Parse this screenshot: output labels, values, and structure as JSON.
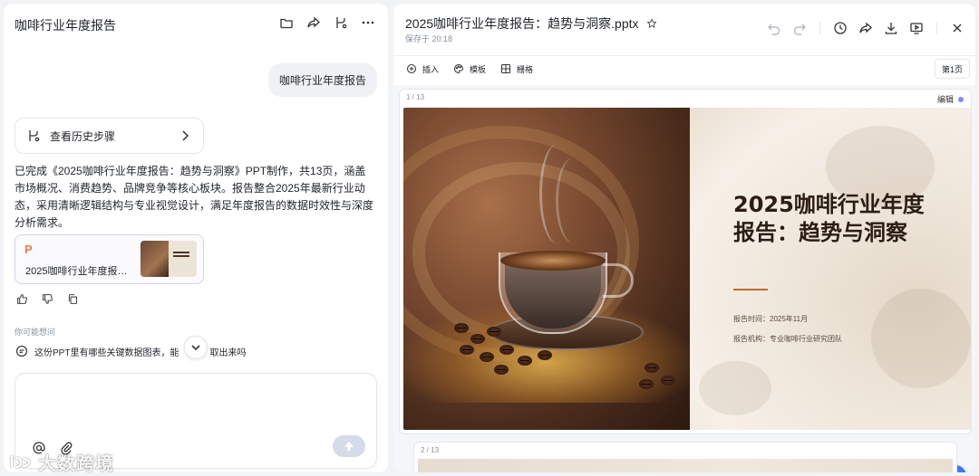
{
  "left_panel": {
    "title": "咖啡行业年度报告",
    "header_icons": [
      "folder-icon",
      "share-icon",
      "branch-icon",
      "more-icon"
    ],
    "user_message": "咖啡行业年度报告",
    "history_button": "查看历史步骤",
    "answer_text": "已完成《2025咖啡行业年度报告：趋势与洞察》PPT制作，共13页，涵盖市场概况、消费趋势、品牌竞争等核心板块。报告整合2025年最新行业动态，采用清晰逻辑结构与专业视觉设计，满足年度报告的数据时效性与深度分析需求。",
    "file_card": {
      "badge": "P",
      "name": "2025咖啡行业年度报告..."
    },
    "feedback_icons": [
      "thumbs-up-icon",
      "thumbs-down-icon",
      "copy-icon"
    ],
    "suggest_heading": "你可能想问",
    "suggestion_before": "这份PPT里有哪些关键数据图表，能",
    "suggestion_after": "取出来吗",
    "composer": {
      "placeholder": "",
      "tools": [
        "at-icon",
        "attach-icon"
      ]
    },
    "watermark": "大数跨境"
  },
  "right_panel": {
    "file_title": "2025咖啡行业年度报告：趋势与洞察.pptx",
    "save_status": "保存于 20:18",
    "toolbar": {
      "insert": "插入",
      "template": "模板",
      "grid": "栅格",
      "page_indicator": "第1页"
    },
    "slides": [
      {
        "index": "1 / 13",
        "edit_label": "编辑",
        "title": "2025咖啡行业年度报告：趋势与洞察",
        "meta_time": "报告时间：2025年11月",
        "meta_org": "报告机构：专业咖啡行业研究团队"
      },
      {
        "index": "2 / 13"
      }
    ]
  },
  "colors": {
    "accent_blue": "#3a7bf7",
    "file_card_border": "#d9cff2",
    "ppt_badge": "#f2784b",
    "slide_rule": "#c06a35"
  }
}
